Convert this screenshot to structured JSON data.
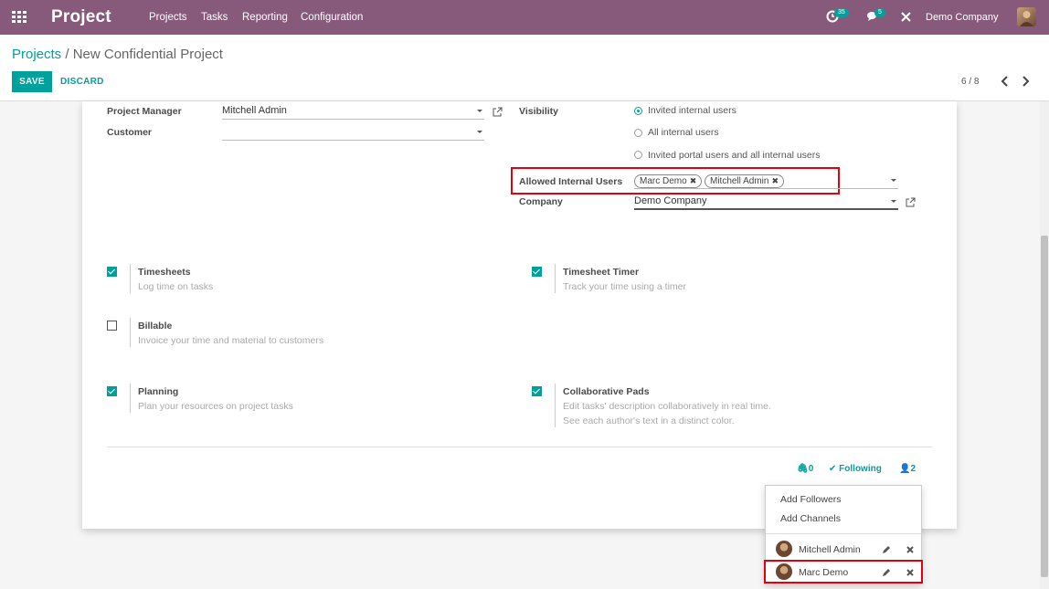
{
  "navbar": {
    "brand": "Project",
    "menus": [
      "Projects",
      "Tasks",
      "Reporting",
      "Configuration"
    ],
    "activity_count": "35",
    "messages_count": "5",
    "company": "Demo Company"
  },
  "breadcrumb": {
    "parent": "Projects",
    "separator": "/",
    "current": "New Confidential Project"
  },
  "buttons": {
    "save": "SAVE",
    "discard": "DISCARD"
  },
  "pager": {
    "value": "6 / 8"
  },
  "form": {
    "project_manager_label": "Project Manager",
    "project_manager_value": "Mitchell Admin",
    "customer_label": "Customer",
    "customer_value": "",
    "visibility_label": "Visibility",
    "visibility_options": [
      "Invited internal users",
      "All internal users",
      "Invited portal users and all internal users"
    ],
    "visibility_selected": 0,
    "allowed_users_label": "Allowed Internal Users",
    "allowed_users": [
      "Marc Demo",
      "Mitchell Admin"
    ],
    "company_label": "Company",
    "company_value": "Demo Company"
  },
  "options": [
    {
      "title": "Timesheets",
      "desc": "Log time on tasks",
      "checked": true
    },
    {
      "title": "Timesheet Timer",
      "desc": "Track your time using a timer",
      "checked": true
    },
    {
      "title": "Billable",
      "desc": "Invoice your time and material to customers",
      "checked": false
    },
    {
      "title": "Planning",
      "desc": "Plan your resources on project tasks",
      "checked": true
    },
    {
      "title": "Collaborative Pads",
      "desc": "Edit tasks' description collaboratively in real time.",
      "desc2": "See each author's text in a distinct color.",
      "checked": true
    }
  ],
  "chatter": {
    "attachments": "0",
    "following": "Following",
    "followers_count": "2"
  },
  "followers_dropdown": {
    "add_followers": "Add Followers",
    "add_channels": "Add Channels",
    "followers": [
      "Mitchell Admin",
      "Marc Demo"
    ]
  },
  "colors": {
    "brand": "#875a7b",
    "accent": "#00a09d",
    "highlight": "#e3000f"
  }
}
